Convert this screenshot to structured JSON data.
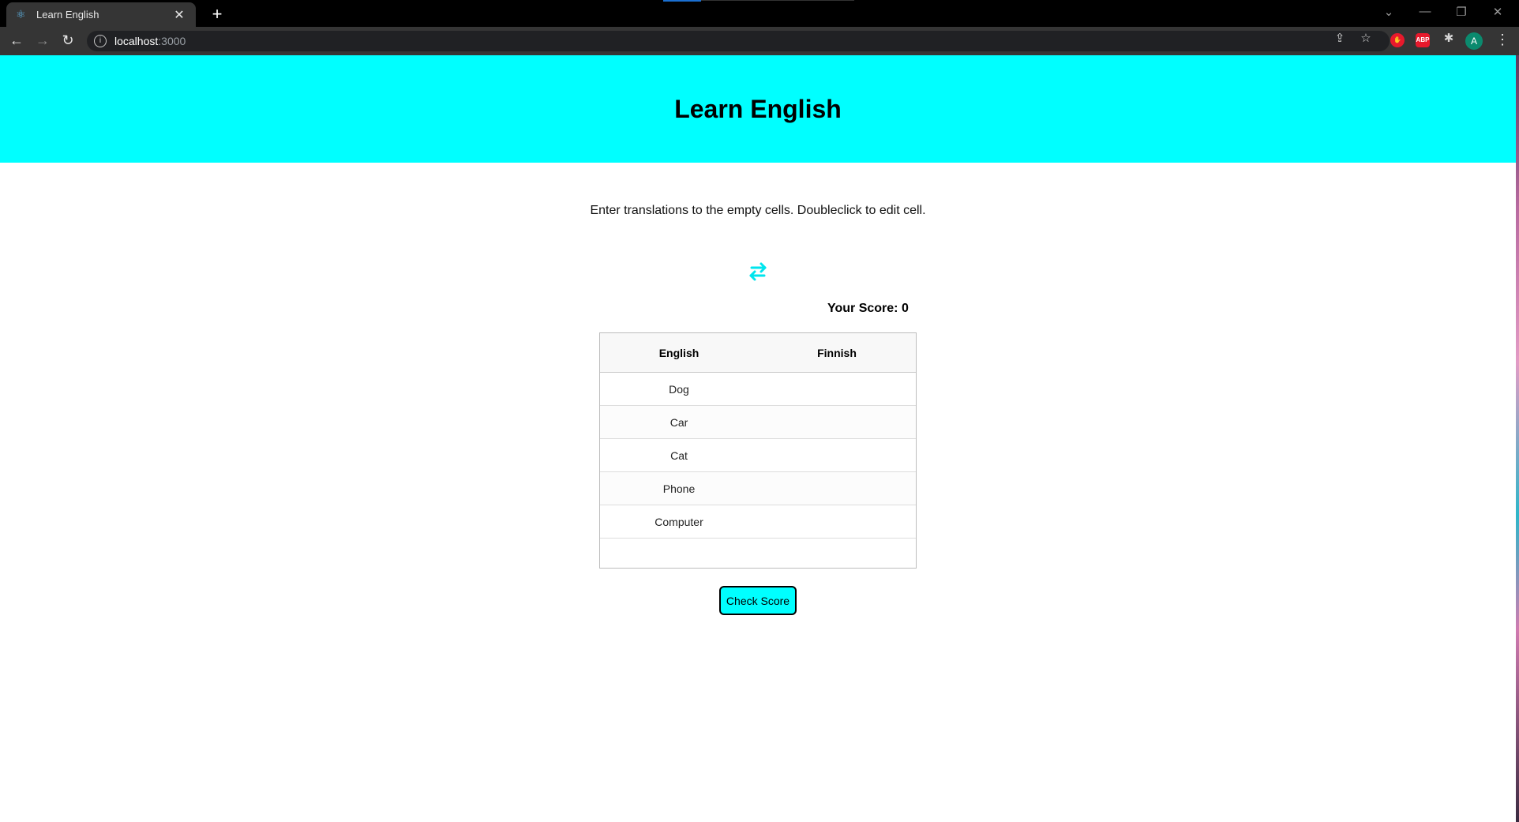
{
  "browser": {
    "tab_title": "Learn English",
    "tab_icon": "react-icon",
    "url_host": "localhost",
    "url_port": ":3000",
    "avatar_letter": "A",
    "ext_abp_label": "ABP"
  },
  "header": {
    "title": "Learn English"
  },
  "main": {
    "instructions": "Enter translations to the empty cells. Doubleclick to edit cell.",
    "score_label": "Your Score: 0",
    "check_button": "Check Score",
    "accent_color": "#00ffff"
  },
  "grid": {
    "columns": [
      "English",
      "Finnish"
    ],
    "rows": [
      {
        "english": "Dog",
        "finnish": ""
      },
      {
        "english": "Car",
        "finnish": ""
      },
      {
        "english": "Cat",
        "finnish": ""
      },
      {
        "english": "Phone",
        "finnish": ""
      },
      {
        "english": "Computer",
        "finnish": ""
      }
    ]
  }
}
